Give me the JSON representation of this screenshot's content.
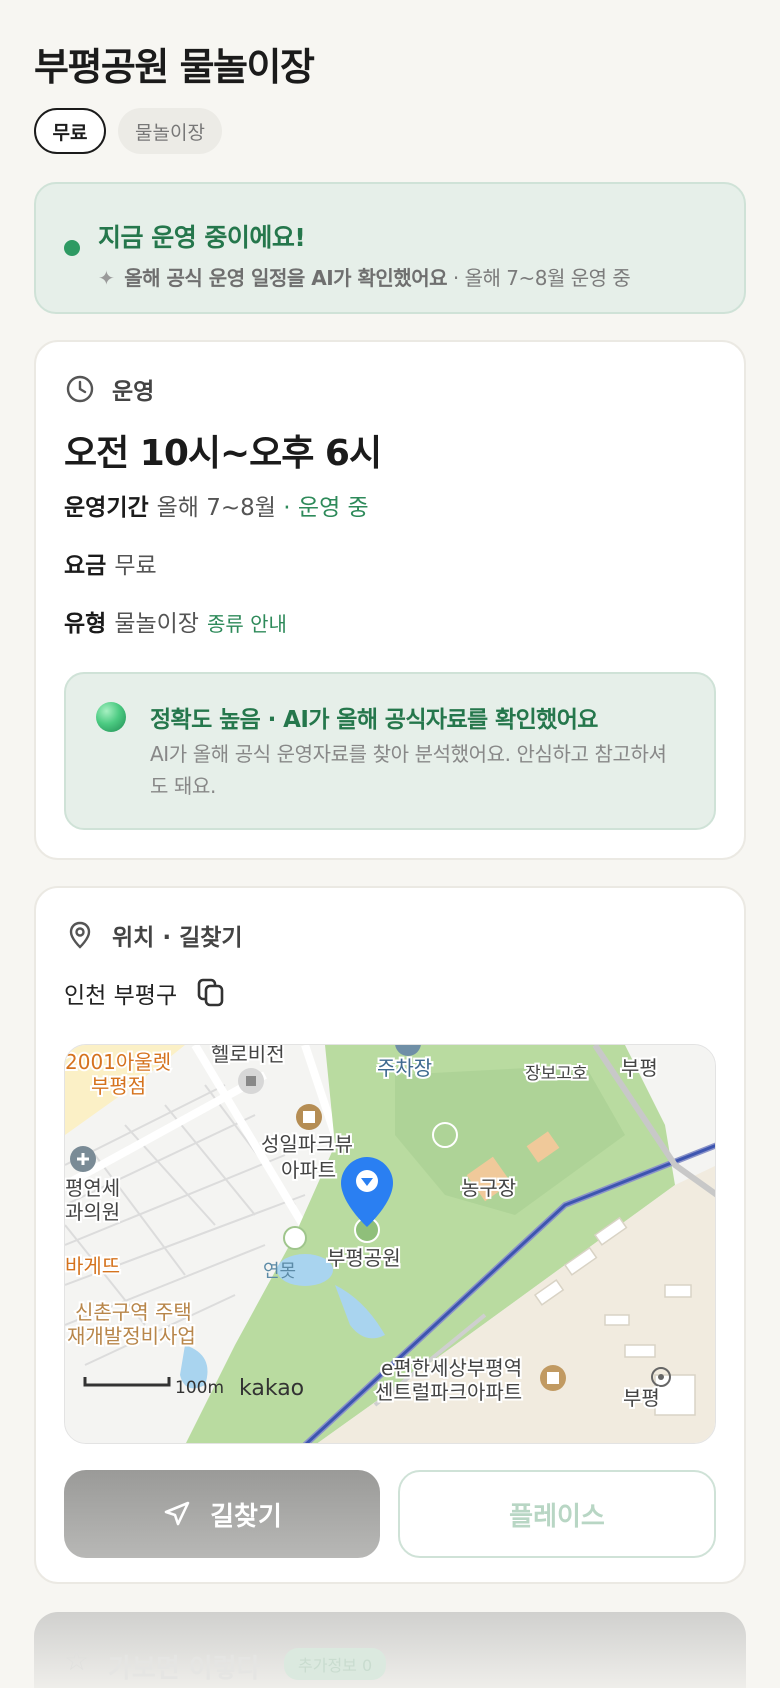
{
  "place": {
    "title": "부평공원 물놀이장",
    "chips": [
      "무료",
      "물놀이장"
    ]
  },
  "status": {
    "title": "지금 운영 중이에요!",
    "ai_note": "올해 공식 운영 일정을 AI가 확인했어요",
    "separator": "·",
    "period_note": "올해 7~8월 운영 중",
    "colors": {
      "accent": "#2e9a63",
      "box": "#e6efe9"
    }
  },
  "hours_card": {
    "label": "운영",
    "icon": "clock-icon",
    "hours": "오전 10시~오후 6시",
    "rows": [
      {
        "key": "운영기간",
        "value": "올해 7~8월",
        "extra": "· 운영 중"
      },
      {
        "key": "요금",
        "value": "무료",
        "extra": ""
      },
      {
        "key": "유형",
        "value": "물놀이장",
        "extra": "종류 안내"
      }
    ],
    "accuracy": {
      "title": "정확도 높음 · AI가 올해 공식자료를 확인했어요",
      "desc": "AI가 올해 공식 운영자료를 찾아 분석했어요. 안심하고 참고하셔도 돼요."
    }
  },
  "location_card": {
    "label": "위치 · 길찾기",
    "icon": "map-pin-icon",
    "address": "인천 부평구",
    "map": {
      "labels": {
        "store": "2001아울렛",
        "store2": "부평점",
        "tv": "헬로비전",
        "parking": "주차장",
        "school": "장보고호",
        "apt1": "성일파크뷰",
        "apt1b": "아파트",
        "clinic": "평연세",
        "clinic2": "과의원",
        "court": "농구장",
        "bakery": "바게뜨",
        "pond": "연못",
        "park": "부평공원",
        "redev1": "신촌구역 주택",
        "redev2": "재개발정비사업",
        "apt2": "e편한세상부평역",
        "apt2b": "센트럴파크아파트",
        "station_edge": "부평",
        "station_top": "부평",
        "scale": "100m",
        "brand": "kakao"
      }
    },
    "buttons": {
      "directions": "길찾기",
      "place": "플레이스"
    }
  },
  "next_section": {
    "title": "가보면 이렇다",
    "badge": "추가정보 0"
  }
}
